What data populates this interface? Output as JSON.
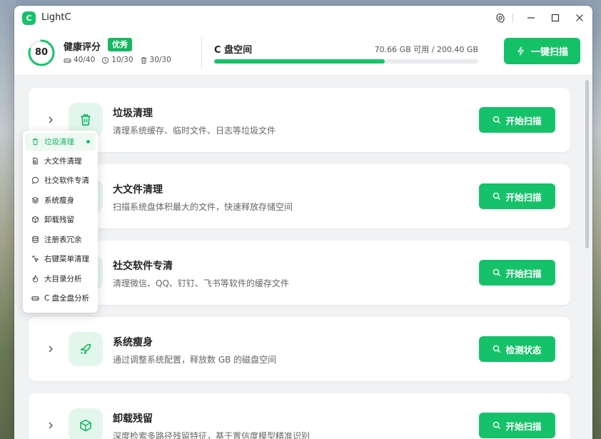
{
  "app": {
    "title": "LightC",
    "logo_letter": "C",
    "accent": "#15c36a"
  },
  "titlebar": {
    "icons": [
      "settings-icon",
      "minimize-icon",
      "maximize-icon",
      "close-icon"
    ]
  },
  "health": {
    "score": "80",
    "score_fraction": 0.8,
    "title": "健康评分",
    "badge": "优秀",
    "stats": [
      {
        "icon": "drive-icon",
        "value": "40/40"
      },
      {
        "icon": "clock-icon",
        "value": "10/30"
      },
      {
        "icon": "trash-icon",
        "value": "30/30"
      }
    ]
  },
  "disk": {
    "title": "C 盘空间",
    "info": "70.66 GB 可用 / 200.40 GB",
    "used_fraction": 0.647
  },
  "one_click_scan": {
    "label": "一键扫描",
    "icon": "bolt-icon"
  },
  "features": [
    {
      "title": "垃圾清理",
      "desc": "清理系统缓存、临时文件、日志等垃圾文件",
      "button": "开始扫描",
      "icon": "trash-icon"
    },
    {
      "title": "大文件清理",
      "desc": "扫描系统盘体积最大的文件，快速释放存储空间",
      "button": "开始扫描",
      "icon": "file-icon"
    },
    {
      "title": "社交软件专清",
      "desc": "清理微信、QQ、钉钉、飞书等软件的缓存文件",
      "button": "开始扫描",
      "icon": "chat-icon"
    },
    {
      "title": "系统瘦身",
      "desc": "通过调整系统配置，释放数 GB 的磁盘空间",
      "button": "检测状态",
      "icon": "rocket-icon"
    },
    {
      "title": "卸载残留",
      "desc": "深度检索多路径残留特征，基于置信度模型精准识别",
      "button": "开始扫描",
      "icon": "box-icon"
    }
  ],
  "menu": {
    "items": [
      {
        "label": "垃圾清理",
        "icon": "trash-icon",
        "active": true
      },
      {
        "label": "大文件清理",
        "icon": "file-icon"
      },
      {
        "label": "社交软件专清",
        "icon": "chat-icon"
      },
      {
        "label": "系统瘦身",
        "icon": "layers-icon"
      },
      {
        "label": "卸载残留",
        "icon": "box-icon"
      },
      {
        "label": "注册表冗余",
        "icon": "database-icon"
      },
      {
        "label": "右键菜单清理",
        "icon": "cursor-icon"
      },
      {
        "label": "大目录分析",
        "icon": "flame-icon"
      },
      {
        "label": "C 盘全盘分析",
        "icon": "drive-icon"
      }
    ]
  }
}
